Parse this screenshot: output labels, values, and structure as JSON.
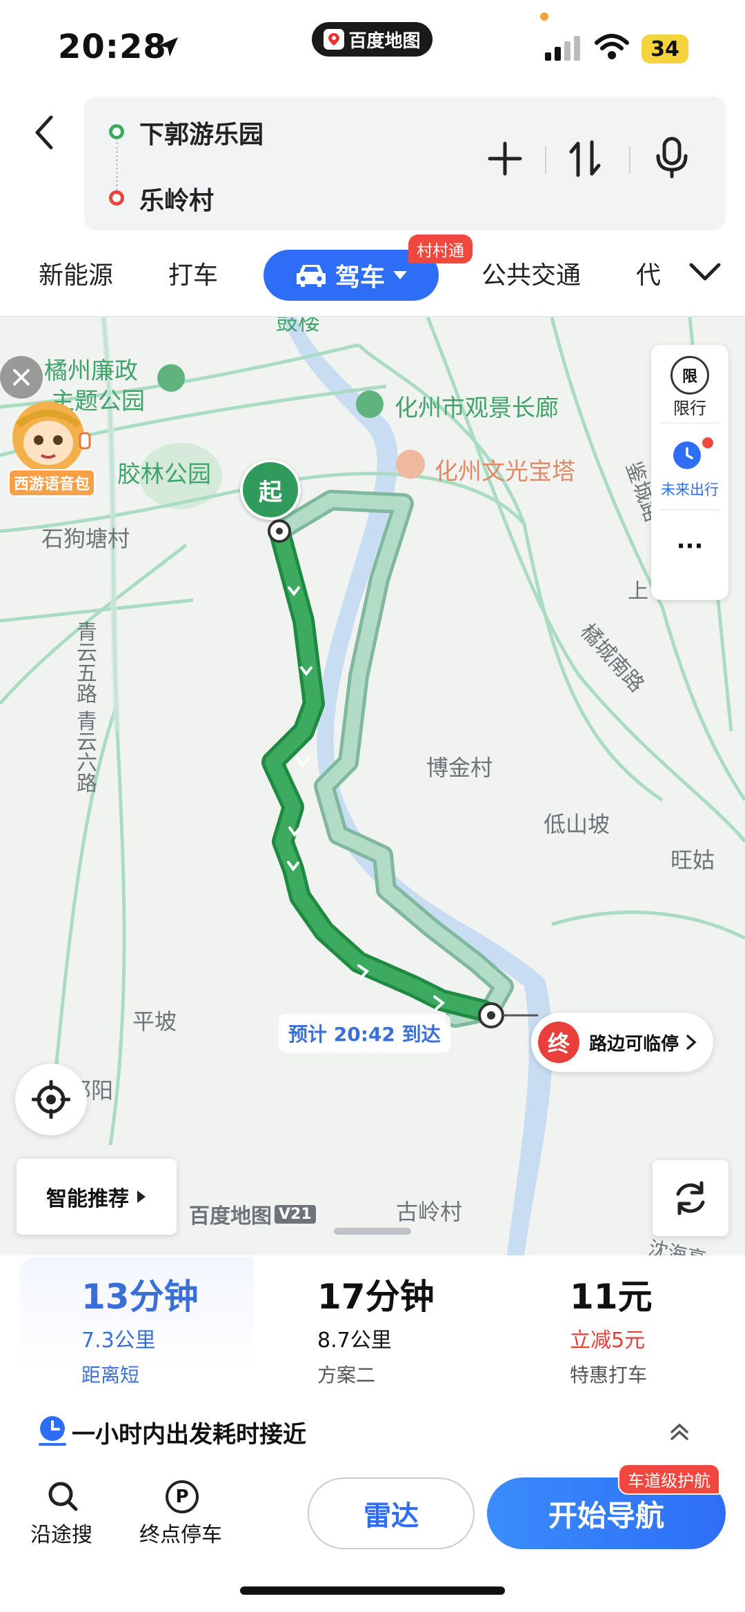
{
  "status": {
    "time": "20:28",
    "battery": "34"
  },
  "app_pill": {
    "name": "百度地图"
  },
  "route": {
    "start": "下郭游乐园",
    "end": "乐岭村"
  },
  "modes": {
    "new_energy": "新能源",
    "taxi": "打车",
    "drive": "驾车",
    "drive_badge": "村村通",
    "transit": "公共交通",
    "more": "代"
  },
  "map": {
    "labels": {
      "gulou": "鼓楼",
      "lianzheng": "橘州廉政",
      "zhuti": "主题公园",
      "guanjing": "化州市观景长廊",
      "jiaolin": "胶林公园",
      "baota": "化州文光宝塔",
      "shigou": "石狗塘村",
      "qingyun": "青云五路 青云六路",
      "jucheng": "橘城南路",
      "bojin": "博金村",
      "dishan": "低山坡",
      "wanggu": "旺姑",
      "pingpo": "平坡",
      "yang": "邦阳",
      "guling": "古岭村",
      "shang": "上",
      "beach": "沈海高",
      "road_right": "鉴城路"
    },
    "start_marker": "起",
    "end_marker": "终",
    "end_label": "路边可临停",
    "eta": "预计 20:42 到达",
    "voice_pack": "西游语音包",
    "side": {
      "restrict": "限行",
      "restrict_icon": "限",
      "future": "未来出行",
      "more": "···"
    },
    "smart_recommend": "智能推荐",
    "watermark": "百度地图",
    "watermark_ver": "V21"
  },
  "options": [
    {
      "time": "13分钟",
      "distance": "7.3公里",
      "tag": "距离短"
    },
    {
      "time": "17分钟",
      "distance": "8.7公里",
      "tag": "方案二"
    },
    {
      "time": "11元",
      "distance": "立减5元",
      "tag": "特惠打车"
    }
  ],
  "depart_tip": "一小时内出发耗时接近",
  "bottom": {
    "search": "沿途搜",
    "parking": "终点停车",
    "parking_icon": "P",
    "radar": "雷达",
    "start_nav": "开始导航",
    "lane_badge": "车道级护航"
  },
  "colors": {
    "accent": "#2e6ef6",
    "route_main": "#3cab60",
    "route_alt": "#a9d6c0",
    "red": "#f0483e"
  }
}
